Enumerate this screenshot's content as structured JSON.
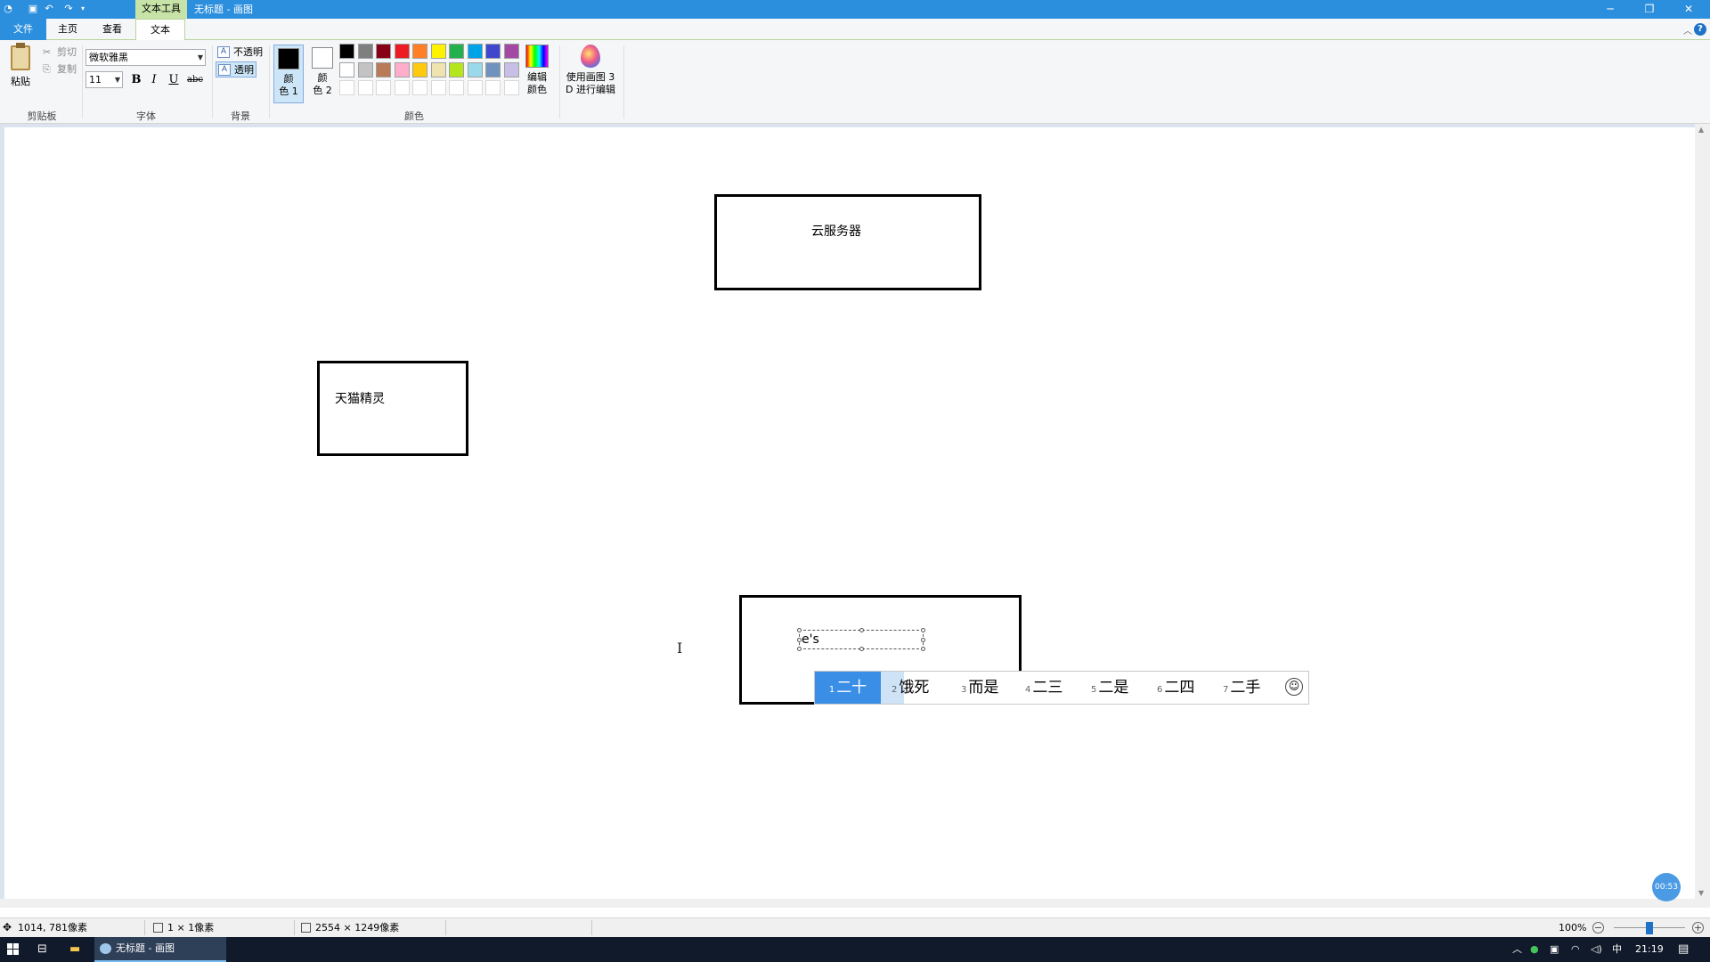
{
  "titlebar": {
    "context_tab": "文本工具",
    "title": "无标题 - 画图",
    "icons": [
      "paint-app-icon",
      "save-icon",
      "undo-icon",
      "redo-icon",
      "customize-quick-access-icon",
      "minimize-icon",
      "restore-icon",
      "close-icon"
    ]
  },
  "menu": {
    "file": "文件",
    "home": "主页",
    "view": "查看",
    "text": "文本"
  },
  "ribbon": {
    "clipboard": {
      "label": "剪贴板",
      "paste": "粘贴",
      "cut": "剪切",
      "copy": "复制"
    },
    "font": {
      "label": "字体",
      "family": "微软雅黑",
      "size": "11",
      "bold": "B",
      "italic": "I",
      "underline": "U",
      "strike": "abc"
    },
    "background": {
      "label": "背景",
      "opaque": "不透明",
      "transparent": "透明"
    },
    "colors": {
      "label": "颜色",
      "color1_a": "颜",
      "color1_b": "色 1",
      "color2_a": "颜",
      "color2_b": "色 2",
      "color1_value": "#000000",
      "color2_value": "#ffffff",
      "palette_row1": [
        "#000000",
        "#7f7f7f",
        "#880015",
        "#ed1c24",
        "#ff7f27",
        "#fff200",
        "#22b14c",
        "#00a2e8",
        "#3f48cc",
        "#a349a4"
      ],
      "palette_row2": [
        "#ffffff",
        "#c3c3c3",
        "#b97a57",
        "#ffaec9",
        "#ffc90e",
        "#efe4b0",
        "#b5e61d",
        "#99d9ea",
        "#7092be",
        "#c8bfe7"
      ],
      "edit_colors_a": "编辑",
      "edit_colors_b": "颜色"
    },
    "paint3d": {
      "line1": "使用画图 3",
      "line2": "D 进行编辑"
    }
  },
  "canvas": {
    "box_cloud_label": "云服务器",
    "box_tmall_label": "天猫精灵",
    "editing_text": "e's"
  },
  "ime": {
    "candidates": [
      {
        "num": "1",
        "text": "二十"
      },
      {
        "num": "2",
        "text": "饿死"
      },
      {
        "num": "3",
        "text": "而是"
      },
      {
        "num": "4",
        "text": "二三"
      },
      {
        "num": "5",
        "text": "二是"
      },
      {
        "num": "6",
        "text": "二四"
      },
      {
        "num": "7",
        "text": "二手"
      }
    ]
  },
  "statusbar": {
    "cursor_pos": "1014, 781像素",
    "selection_size": "1 × 1像素",
    "canvas_size": "2554 × 1249像素",
    "zoom": "100%",
    "zoom_level_percent": 100
  },
  "recording_timer": "00:53",
  "taskbar": {
    "app_label": "无标题 - 画图",
    "ime_indicator": "中",
    "clock": "21:19"
  }
}
